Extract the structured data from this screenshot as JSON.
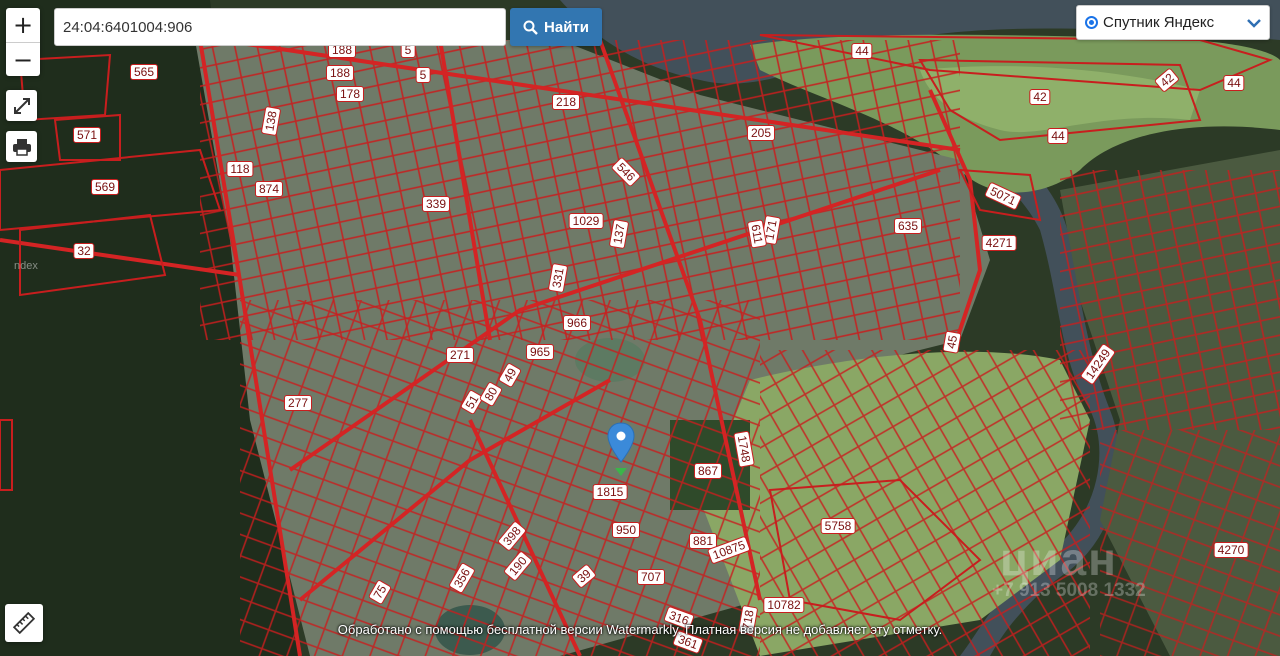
{
  "search": {
    "value": "24:04:6401004:906",
    "button_label": "Найти"
  },
  "controls": {
    "zoom_in": "+",
    "zoom_out": "−"
  },
  "layer_select": {
    "selected": "Спутник Яндекс"
  },
  "map": {
    "parcel_labels": [
      "188",
      "5",
      "565",
      "188",
      "5",
      "178",
      "571",
      "218",
      "138",
      "205",
      "118",
      "874",
      "546",
      "569",
      "339",
      "1029",
      "137",
      "171",
      "611",
      "635",
      "32",
      "331",
      "966",
      "965",
      "271",
      "277",
      "51",
      "49",
      "80",
      "1748",
      "867",
      "1815",
      "950",
      "881",
      "398",
      "10875",
      "5758",
      "190",
      "356",
      "707",
      "39",
      "75",
      "10782",
      "316",
      "718",
      "361",
      "44",
      "42",
      "44",
      "44",
      "42",
      "5071",
      "4271",
      "14249",
      "45",
      "4270"
    ],
    "attribution": "ndex",
    "marker": "location-pin"
  },
  "watermark": {
    "text": "Обработано с помощью бесплатной версии Watermarkly. Платная версия не добавляет эту отметку.",
    "brand": "циан",
    "phone": "+7 913 5008 1332"
  },
  "colors": {
    "parcel_border": "#c81e1e",
    "search_button": "#3276b1",
    "marker": "#3b8ad9"
  }
}
